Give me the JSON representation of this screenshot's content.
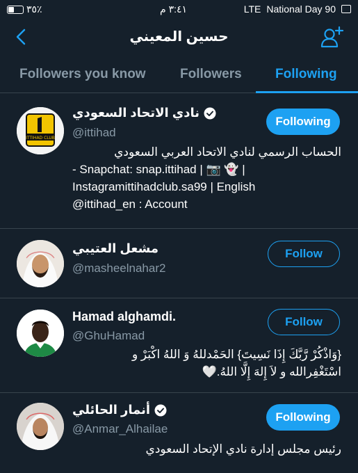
{
  "status_bar": {
    "battery": "٣٥٪",
    "battery_level": 0.35,
    "time": "٣:٤١ م",
    "network": "LTE",
    "carrier": "National Day 90"
  },
  "header": {
    "title": "حسين المعيني"
  },
  "tabs": [
    {
      "label": "Followers you know",
      "active": false
    },
    {
      "label": "Followers",
      "active": false
    },
    {
      "label": "Following",
      "active": true
    }
  ],
  "accounts": [
    {
      "name": "نادي الاتحاد السعودي",
      "handle": "@ittihad",
      "verified": true,
      "button": "Following",
      "bio_lines": [
        "الحساب الرسمي لنادي الاتحاد العربي السعودي",
        "- Snapchat: snap.ittihad | 📷 👻 |",
        "Instagramittihadclub.sa99 | English",
        "@ittihad_en : Account"
      ]
    },
    {
      "name": "مشعل العتيبي",
      "handle": "@masheelnahar2",
      "verified": false,
      "button": "Follow"
    },
    {
      "name": "Hamad alghamdi.",
      "handle": "@GhuHamad",
      "verified": false,
      "button": "Follow",
      "bio_lines": [
        "{وَاذْكُرْ رَّبَّكَ إِذَا نَسِيتَ} الحَمْدللهُ وَ اللهُ اكْبَرْ و",
        "اسْتَغْفِرالله و لاَ إِلهَ إِلَّا اللهُ.🤍"
      ]
    },
    {
      "name": "أنمار الحائلي",
      "handle": "@Anmar_Alhailae",
      "verified": true,
      "button": "Following",
      "bio_lines": [
        "رئيس مجلس إدارة نادي الإتحاد السعودي"
      ]
    }
  ],
  "colors": {
    "background": "#15202b",
    "accent": "#1da1f2",
    "muted": "#8899a6",
    "divider": "#38444d"
  }
}
